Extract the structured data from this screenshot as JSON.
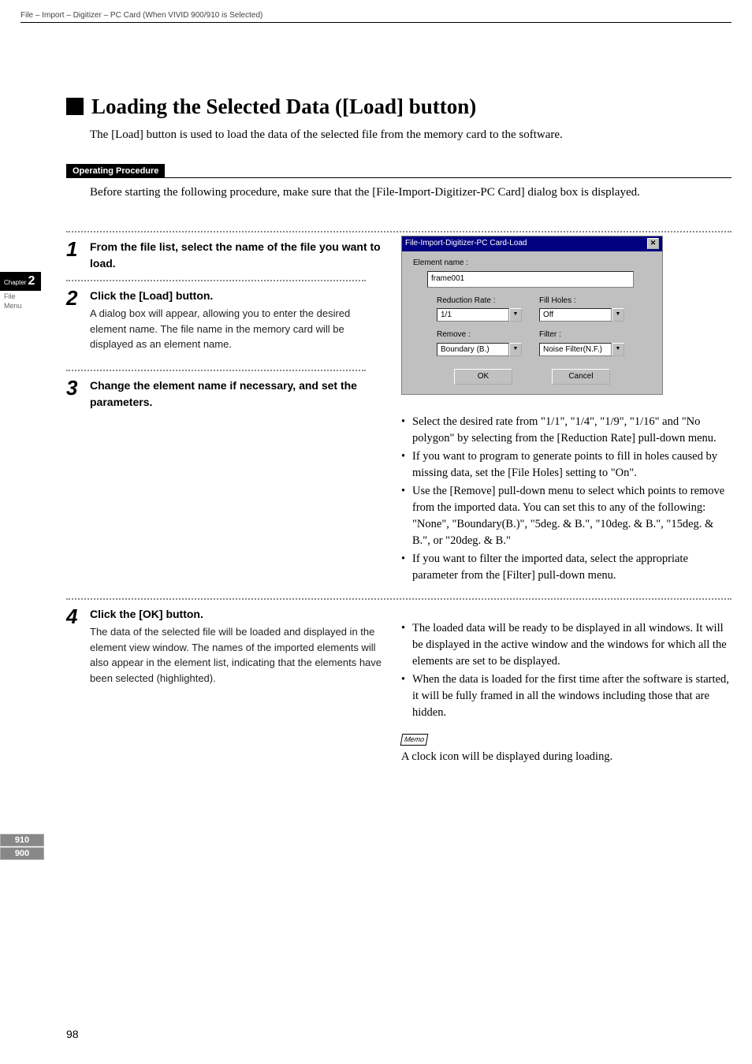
{
  "breadcrumb": "File – Import – Digitizer – PC Card (When VIVID 900/910 is Selected)",
  "chapter": {
    "prefix": "Chapter",
    "num": "2",
    "line1": "File",
    "line2": "Menu"
  },
  "sideLabels": [
    "910",
    "900"
  ],
  "section": {
    "title": "Loading the Selected Data ([Load] button)",
    "intro": "The [Load] button is used to load the data of the selected file from the memory card to the software."
  },
  "opProc": {
    "label": "Operating Procedure",
    "intro": "Before starting the following procedure, make sure that the [File-Import-Digitizer-PC Card] dialog box is displayed."
  },
  "steps": {
    "s1": {
      "num": "1",
      "title": "From the file list, select the name of the file you want to load."
    },
    "s2": {
      "num": "2",
      "title": "Click the [Load] button.",
      "desc": "A dialog box will appear, allowing you to enter the desired element name.\nThe file name in the memory card will be displayed as an element name."
    },
    "s3": {
      "num": "3",
      "title": "Change the element name if necessary, and set the parameters."
    },
    "s4": {
      "num": "4",
      "title": "Click the [OK] button.",
      "desc": "The data of the selected file will be loaded and displayed in the element view window. The names of the imported elements will also appear in the element list, indicating that the elements have been selected (highlighted)."
    }
  },
  "dialog": {
    "title": "File-Import-Digitizer-PC Card-Load",
    "elementLabel": "Element name :",
    "elementValue": "frame001",
    "reductionLabel": "Reduction Rate :",
    "reductionValue": "1/1",
    "fillLabel": "Fill Holes :",
    "fillValue": "Off",
    "removeLabel": "Remove :",
    "removeValue": "Boundary (B.)",
    "filterLabel": "Filter :",
    "filterValue": "Noise Filter(N.F.)",
    "ok": "OK",
    "cancel": "Cancel"
  },
  "bullets3": [
    "Select the desired rate from \"1/1\", \"1/4\", \"1/9\", \"1/16\" and \"No polygon\" by selecting from the [Reduction Rate] pull-down menu.",
    "If you want to program to generate points to fill in holes caused by missing data, set the [File Holes] setting to \"On\".",
    "Use the [Remove] pull-down menu to select which points to remove from the imported data. You can set this to any of the following: \"None\", \"Boundary(B.)\", \"5deg. & B.\", \"10deg. & B.\", \"15deg. & B.\", or \"20deg. & B.\"",
    "If you want to filter the imported data, select the appropriate parameter from the [Filter] pull-down menu."
  ],
  "bullets4": [
    "The loaded data will be ready to be displayed in all windows. It will be displayed in the active window and the windows for which all the elements are set to be displayed.",
    "When the data is loaded for the first time after the software is started, it will be fully framed in all the windows including those that are hidden."
  ],
  "memo": {
    "label": "Memo",
    "text": "A clock icon will be displayed during loading."
  },
  "pageNum": "98"
}
